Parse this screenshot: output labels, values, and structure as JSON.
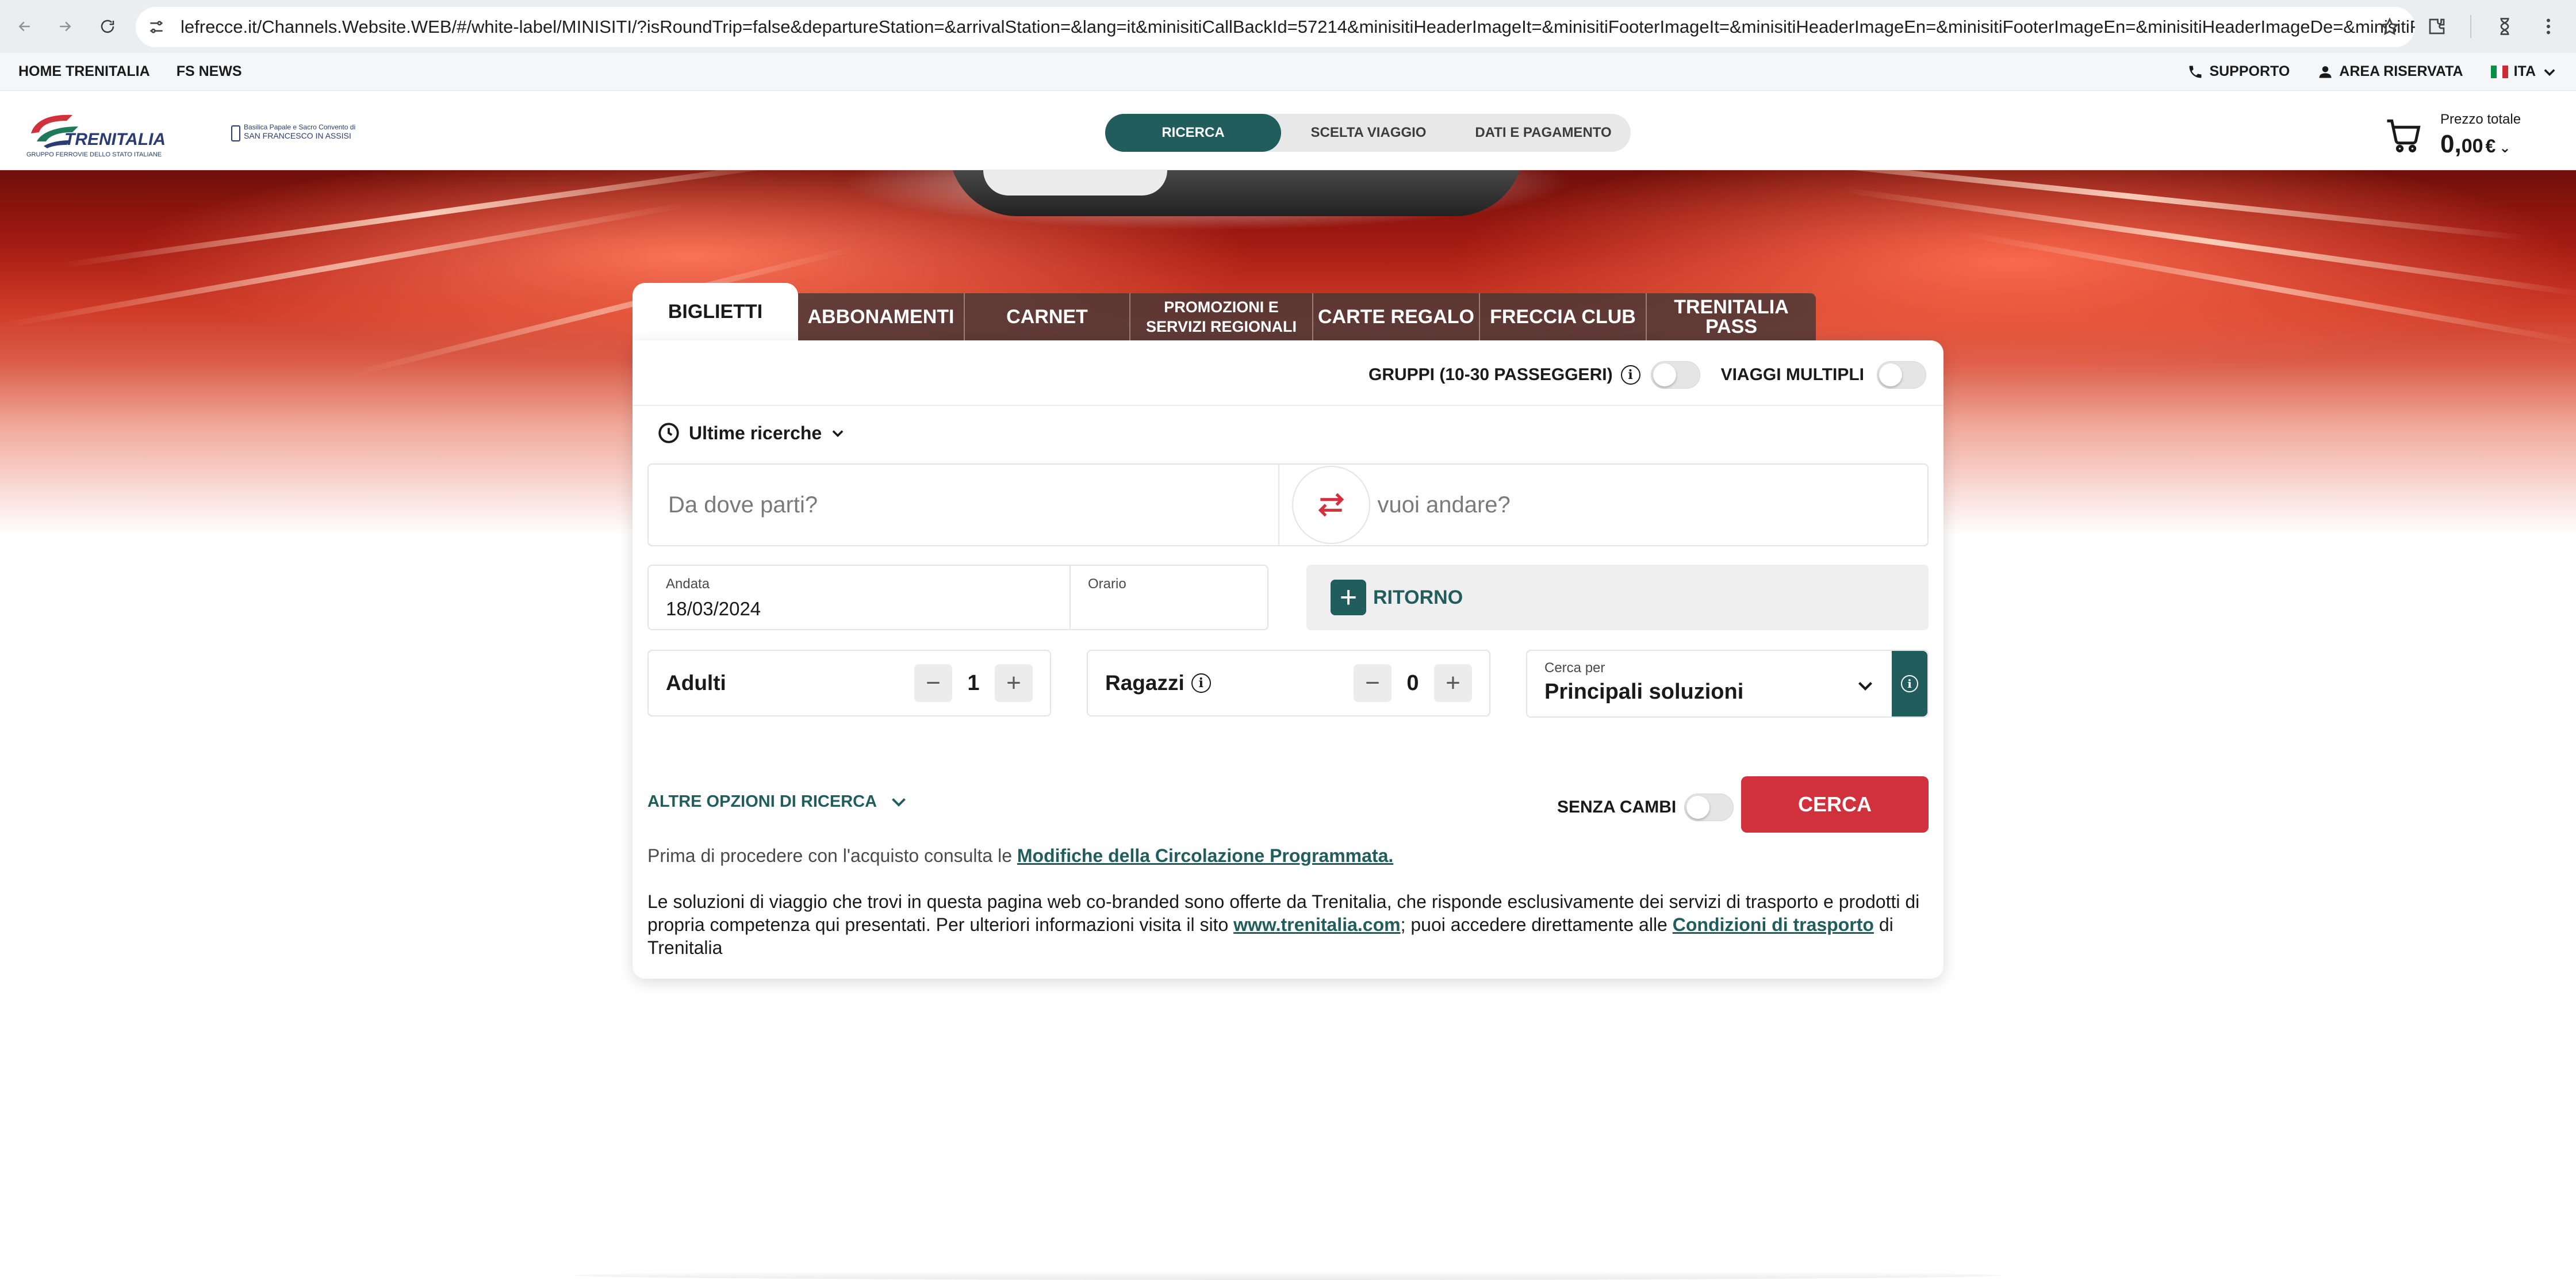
{
  "browser": {
    "url": "lefrecce.it/Channels.Website.WEB/#/white-label/MINISITI/?isRoundTrip=false&departureStation=&arrivalStation=&lang=it&minisitiCallBackId=57214&minisitiHeaderImageIt=&minisitiFooterImageIt=&minisitiHeaderImageEn=&minisitiFooterImageEn=&minisitiHeaderImageDe=&minisitiFoote..."
  },
  "util_bar": {
    "left_links": [
      "HOME TRENITALIA",
      "FS NEWS"
    ],
    "support": "SUPPORTO",
    "reserved_area": "AREA RISERVATA",
    "language": "ITA"
  },
  "header": {
    "brand": "TRENITALIA",
    "brand_sub": "GRUPPO FERROVIE DELLO STATO ITALIANE",
    "partner_line1": "Basilica Papale e Sacro Convento di",
    "partner_line2": "SAN FRANCESCO IN ASSISI",
    "steps": [
      "RICERCA",
      "SCELTA VIAGGIO",
      "DATI E PAGAMENTO"
    ],
    "active_step": "RICERCA",
    "price_label": "Prezzo totale",
    "price_int": "0,",
    "price_dec": "00",
    "price_currency": "€"
  },
  "tabs": {
    "biglietti": "BIGLIETTI",
    "abbonamenti": "ABBONAMENTI",
    "carnet": "CARNET",
    "promozioni_1": "PROMOZIONI E",
    "promozioni_2": "SERVIZI REGIONALI",
    "carte_regalo": "CARTE REGALO",
    "freccia_club": "FRECCIA CLUB",
    "trenitalia_pass": "TRENITALIA PASS"
  },
  "form": {
    "groups_label": "GRUPPI (10-30 PASSEGGERI)",
    "multi_label": "VIAGGI MULTIPLI",
    "recent_label": "Ultime ricerche",
    "from_placeholder": "Da dove parti?",
    "to_placeholder": "Dove vuoi andare?",
    "andata_label": "Andata",
    "andata_value": "18/03/2024",
    "orario_label": "Orario",
    "return_label": "RITORNO",
    "adults_label": "Adulti",
    "adults_value": "1",
    "youth_label": "Ragazzi",
    "youth_value": "0",
    "search_by_label": "Cerca per",
    "search_by_value": "Principali soluzioni",
    "more_options": "ALTRE OPZIONI DI RICERCA",
    "no_change_label": "SENZA CAMBI",
    "search_button": "CERCA"
  },
  "notice": {
    "text": "Prima di procedere con l'acquisto consulta le ",
    "link": "Modifiche della Circolazione Programmata."
  },
  "disclaimer": {
    "part1": "Le soluzioni di viaggio che trovi in questa pagina web co-branded sono offerte da Trenitalia, che risponde esclusivamente dei servizi di trasporto e prodotti di propria competenza qui presentati. Per ulteriori informazioni visita il sito ",
    "link1": "www.trenitalia.com",
    "part2": "; puoi accedere direttamente alle ",
    "link2": "Condizioni di trasporto",
    "part3": " di Trenitalia"
  },
  "colors": {
    "primary_green": "#215d5d",
    "accent_red": "#d0313c",
    "brand_red": "#d0313c",
    "brand_blue": "#2a3c72"
  },
  "icons": [
    "back-icon",
    "forward-icon",
    "reload-icon",
    "site-settings-icon",
    "bookmark-star-icon",
    "extensions-icon",
    "profile-icon",
    "menu-icon",
    "phone-icon",
    "user-icon",
    "italy-flag-icon",
    "cart-icon",
    "clock-icon",
    "swap-icon",
    "plus-icon",
    "minus-icon",
    "info-icon",
    "chevron-down-icon"
  ]
}
